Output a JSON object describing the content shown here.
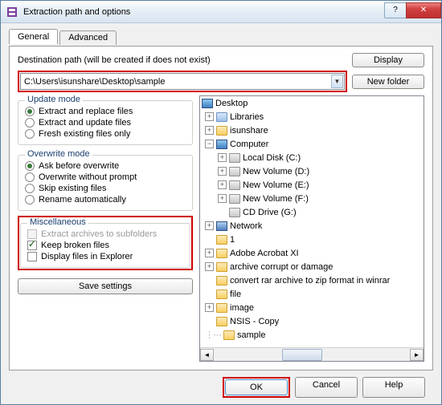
{
  "window": {
    "title": "Extraction path and options"
  },
  "tabs": {
    "general": "General",
    "advanced": "Advanced"
  },
  "dest": {
    "label": "Destination path (will be created if does not exist)",
    "value": "C:\\Users\\isunshare\\Desktop\\sample",
    "display_btn": "Display",
    "newfolder_btn": "New folder"
  },
  "update": {
    "legend": "Update mode",
    "opt1": "Extract and replace files",
    "opt2": "Extract and update files",
    "opt3": "Fresh existing files only"
  },
  "overwrite": {
    "legend": "Overwrite mode",
    "opt1": "Ask before overwrite",
    "opt2": "Overwrite without prompt",
    "opt3": "Skip existing files",
    "opt4": "Rename automatically"
  },
  "misc": {
    "legend": "Miscellaneous",
    "opt1": "Extract archives to subfolders",
    "opt2": "Keep broken files",
    "opt3": "Display files in Explorer"
  },
  "save_btn": "Save settings",
  "tree": {
    "desktop": "Desktop",
    "libraries": "Libraries",
    "isunshare": "isunshare",
    "computer": "Computer",
    "local_c": "Local Disk (C:)",
    "vol_d": "New Volume (D:)",
    "vol_e": "New Volume (E:)",
    "vol_f": "New Volume (F:)",
    "cd_g": "CD Drive (G:)",
    "network": "Network",
    "one": "1",
    "acrobat": "Adobe Acrobat XI",
    "corrupt": "archive corrupt or damage",
    "convert": "convert rar archive to zip format in winrar",
    "file": "file",
    "image": "image",
    "nsis": "NSIS - Copy",
    "sample": "sample"
  },
  "buttons": {
    "ok": "OK",
    "cancel": "Cancel",
    "help": "Help"
  }
}
